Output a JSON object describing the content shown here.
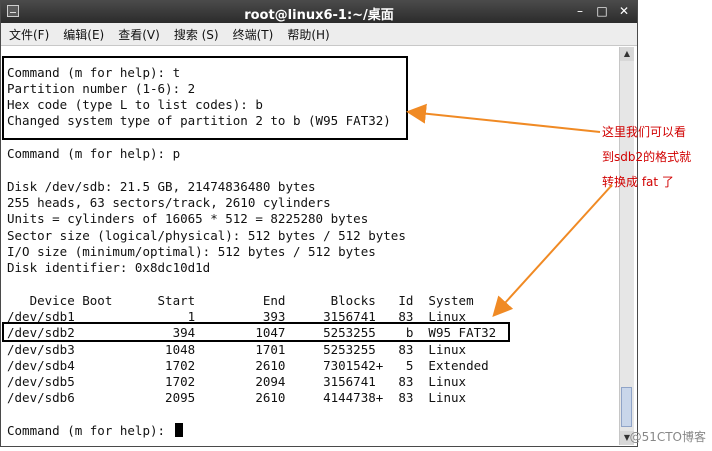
{
  "window": {
    "title": "root@linux6-1:~/桌面",
    "controls": [
      "–",
      "□",
      "✕"
    ]
  },
  "menu": [
    {
      "label": "文件(F)"
    },
    {
      "label": "编辑(E)"
    },
    {
      "label": "查看(V)"
    },
    {
      "label": "搜索 (S)"
    },
    {
      "label": "终端(T)"
    },
    {
      "label": "帮助(H)"
    }
  ],
  "terminal": {
    "lines": [
      "Command (m for help): t",
      "Partition number (1-6): 2",
      "Hex code (type L to list codes): b",
      "Changed system type of partition 2 to b (W95 FAT32)",
      "",
      "Command (m for help): p",
      "",
      "Disk /dev/sdb: 21.5 GB, 21474836480 bytes",
      "255 heads, 63 sectors/track, 2610 cylinders",
      "Units = cylinders of 16065 * 512 = 8225280 bytes",
      "Sector size (logical/physical): 512 bytes / 512 bytes",
      "I/O size (minimum/optimal): 512 bytes / 512 bytes",
      "Disk identifier: 0x8dc10d1d",
      "",
      "   Device Boot      Start         End      Blocks   Id  System",
      "/dev/sdb1               1         393     3156741   83  Linux",
      "/dev/sdb2             394        1047     5253255    b  W95 FAT32",
      "/dev/sdb3            1048        1701     5253255   83  Linux",
      "/dev/sdb4            1702        2610     7301542+   5  Extended",
      "/dev/sdb5            1702        2094     3156741   83  Linux",
      "/dev/sdb6            2095        2610     4144738+  83  Linux",
      "",
      "Command (m for help): "
    ]
  },
  "annotation": {
    "lines": [
      "这里我们可以看",
      "到sdb2的格式就",
      "转换成 fat 了"
    ],
    "color": "#d10000",
    "arrow_color": "#f08a24"
  },
  "watermark": "@51CTO博客"
}
